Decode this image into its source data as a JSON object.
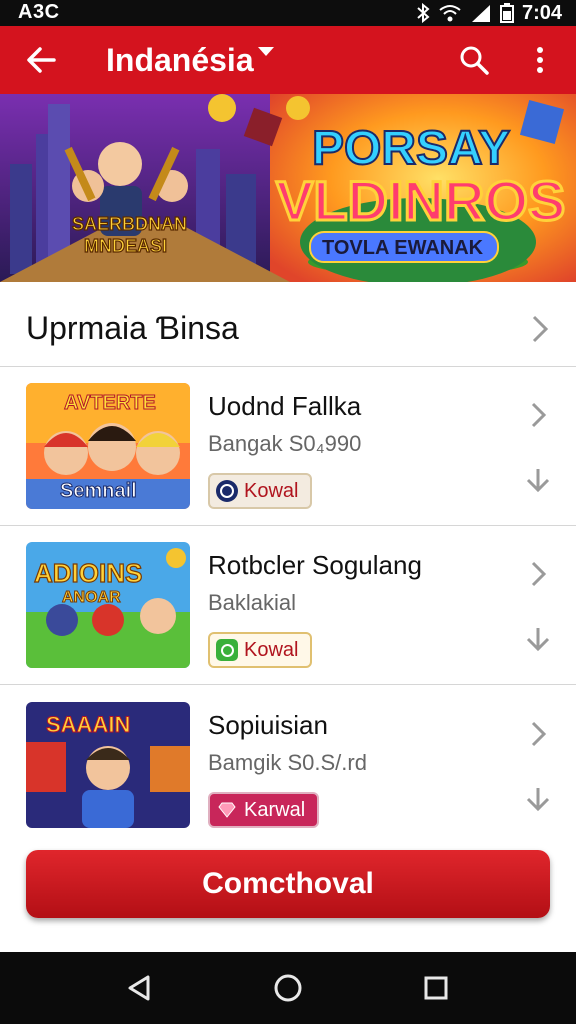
{
  "status_bar": {
    "carrier": "A3C",
    "time": "7:04"
  },
  "app_bar": {
    "title": "Indanésia",
    "icons": [
      "back-arrow-icon",
      "dropdown-caret-icon",
      "search-icon",
      "more-vert-icon"
    ]
  },
  "banner": {
    "left_text": [
      "SAERBDNAN",
      "MNDEASI"
    ],
    "right_title_1": "PORSAY",
    "right_title_2": "VLDINROS",
    "right_subtitle": "TOVLA EWANAK"
  },
  "section": {
    "title": "Uprmaia Ɓinsa"
  },
  "games": [
    {
      "title": "Uodnd Fallka",
      "subtitle": "Bangak S0₄990",
      "badge": "Kowal",
      "badge_icon": "brand-circle-icon",
      "thumb_text_1": "AVTERTE",
      "thumb_text_2": "Semnail"
    },
    {
      "title": "Rotbcler Sogulang",
      "subtitle": "Baklakial",
      "badge": "Kowal",
      "badge_icon": "green-square-icon",
      "thumb_text_1": "ADIOINS",
      "thumb_text_2": "ANOAR"
    },
    {
      "title": "Sopiuisian",
      "subtitle": "Bamgik S0.S/.rd",
      "badge": "Karwal",
      "badge_icon": "gem-icon",
      "thumb_text_1": "SAAAIN",
      "thumb_text_2": ""
    }
  ],
  "cta": {
    "label": "Comcthoval"
  },
  "colors": {
    "primary": "#d4131e",
    "status_bar": "#0d0d0d",
    "nav_bar": "#0b0b0b"
  }
}
